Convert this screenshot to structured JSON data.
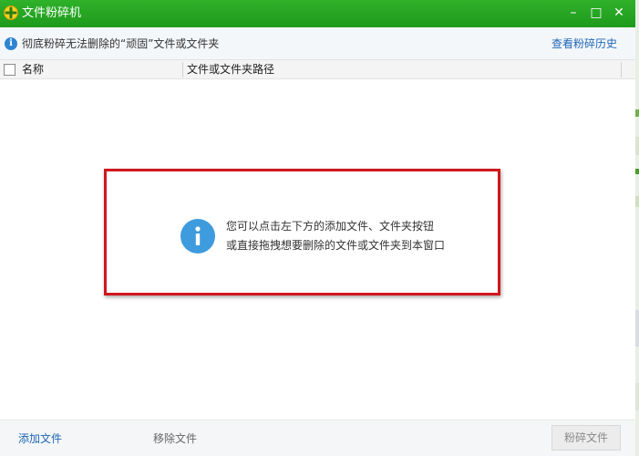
{
  "window": {
    "title": "文件粉碎机",
    "minimize_glyph": "–",
    "maximize_glyph": "□",
    "close_glyph": "✕"
  },
  "infobar": {
    "icon": "info-icon",
    "icon_glyph": "i",
    "text": "彻底粉碎无法删除的“顽固”文件或文件夹",
    "history_link": "查看粉碎历史"
  },
  "table": {
    "columns": [
      "名称",
      "文件或文件夹路径"
    ],
    "rows": []
  },
  "empty_state": {
    "icon": "info-icon",
    "line1": "您可以点击左下方的添加文件、文件夹按钮",
    "line2": "或直接拖拽想要删除的文件或文件夹到本窗口",
    "highlight_color": "#d0181e"
  },
  "footer": {
    "add_file": "添加文件",
    "remove_file": "移除文件",
    "shred": "粉碎文件"
  },
  "colors": {
    "titlebar": "#2fb12a",
    "link": "#1e66b8",
    "info_blue": "#3e9bde"
  }
}
